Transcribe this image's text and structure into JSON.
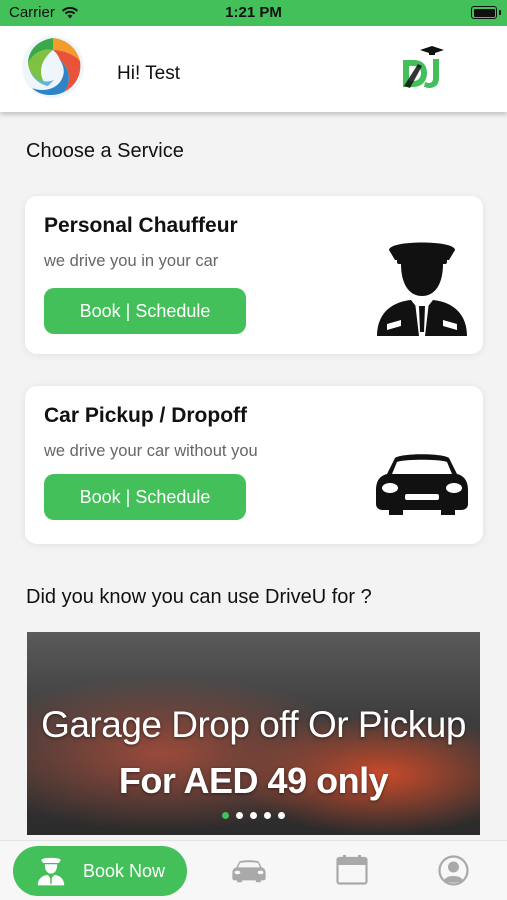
{
  "status_bar": {
    "carrier": "Carrier",
    "time": "1:21 PM"
  },
  "header": {
    "greeting": "Hi! Test",
    "brand_logo_text": "DU"
  },
  "services_section": {
    "title": "Choose a Service",
    "cards": [
      {
        "title": "Personal Chauffeur",
        "subtitle": "we drive you in your car",
        "button_label": "Book | Schedule",
        "icon": "chauffeur-icon"
      },
      {
        "title": "Car Pickup / Dropoff",
        "subtitle": "we drive your car without you",
        "button_label": "Book | Schedule",
        "icon": "car-icon"
      }
    ]
  },
  "promo_section": {
    "title": "Did you know you can use DriveU for ?",
    "banner": {
      "line1": "Garage Drop off Or Pickup",
      "line2": "For AED 49 only",
      "slide_count": 5,
      "active_slide": 1
    }
  },
  "bottom_nav": {
    "book_now_label": "Book Now",
    "items": [
      "book-now",
      "my-cars",
      "bookings-calendar",
      "profile"
    ]
  },
  "colors": {
    "accent_green": "#43c05a",
    "background": "#f3f3f3"
  }
}
